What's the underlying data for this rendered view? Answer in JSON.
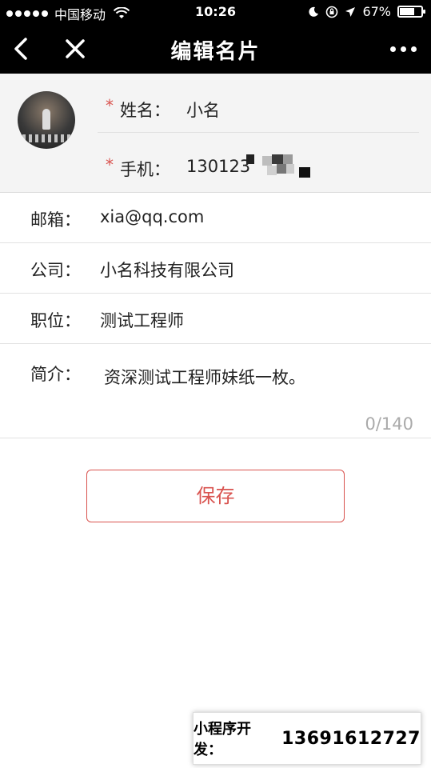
{
  "status_bar": {
    "carrier": "中国移动",
    "time": "10:26",
    "battery_percent": "67%"
  },
  "nav": {
    "title": "编辑名片",
    "back_icon": "chevron-left-icon",
    "close_icon": "close-icon",
    "more_icon": "more-dots-icon"
  },
  "profile": {
    "required_mark": "*",
    "name_label": "姓名：",
    "name_value": "小名",
    "phone_label": "手机：",
    "phone_value": "130123"
  },
  "form": {
    "email_label": "邮箱：",
    "email_value": "xia@qq.com",
    "company_label": "公司：",
    "company_value": "小名科技有限公司",
    "position_label": "职位：",
    "position_value": "测试工程师",
    "intro_label": "简介：",
    "intro_value": "资深测试工程师妹纸一枚。",
    "intro_counter": "0/140"
  },
  "save_label": "保存",
  "promo": {
    "label": "小程序开发：",
    "phone": "13691612727"
  },
  "colors": {
    "accent": "#d9534f",
    "nav_background": "#000000",
    "header_background": "#f4f4f4"
  }
}
